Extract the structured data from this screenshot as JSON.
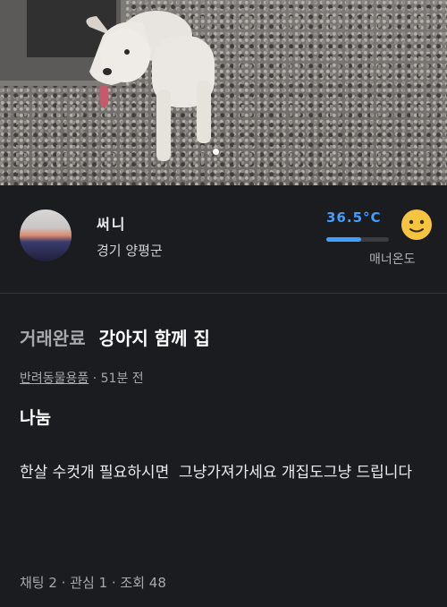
{
  "product": {
    "image_dots": 1,
    "active_dot": 0
  },
  "seller": {
    "nickname": "써니",
    "location": "경기 양평군",
    "location_extra": "",
    "manner_temperature": "36.5°C",
    "manner_level": 0.55,
    "manner_label": "매너온도",
    "accent_color": "#3fa0ff"
  },
  "listing": {
    "status": "거래완료",
    "title": "강아지 함께 집",
    "category": "반려동물용품",
    "time_ago": " · 51분 전",
    "price": "나눔",
    "description": "한살 수컷개 필요하시면  그냥가져가세요 개집도그냥 드립니다"
  },
  "stats": {
    "text": "채팅 2 · 관심 1 · 조회 48"
  }
}
